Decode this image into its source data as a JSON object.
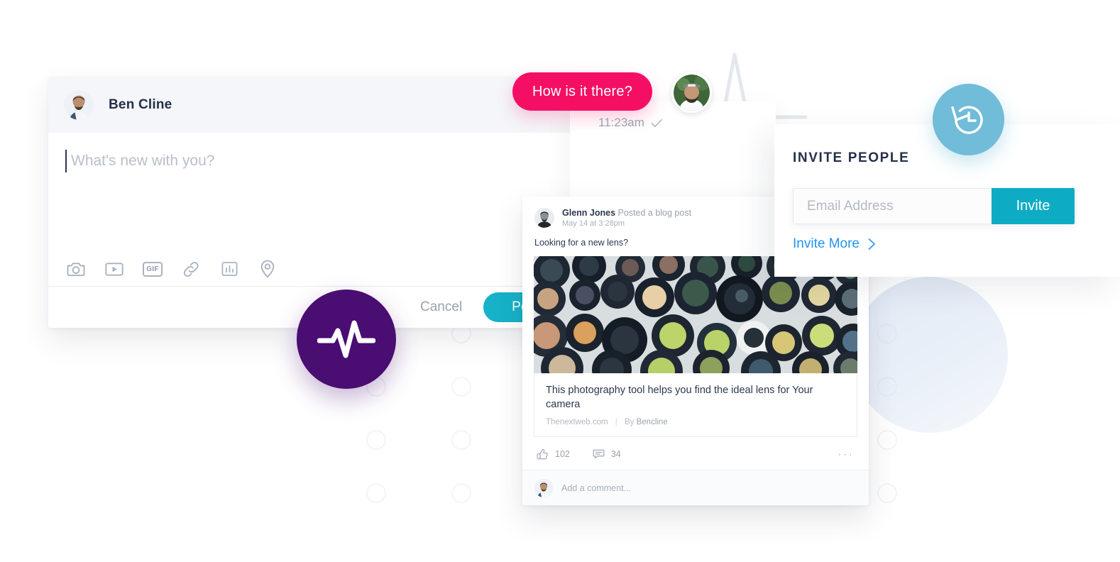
{
  "composer": {
    "user_name": "Ben Cline",
    "placeholder": "What's new with you?",
    "tools": [
      {
        "name": "camera-icon",
        "label": "Photo"
      },
      {
        "name": "video-icon",
        "label": "Video"
      },
      {
        "name": "gif-icon",
        "label": "GIF"
      },
      {
        "name": "link-icon",
        "label": "Link"
      },
      {
        "name": "poll-icon",
        "label": "Poll"
      },
      {
        "name": "location-icon",
        "label": "Location"
      }
    ],
    "gif_label": "GIF",
    "cancel_label": "Cancel",
    "post_label": "Post"
  },
  "chat": {
    "message_text": "How is it there?",
    "timestamp": "11:23am",
    "read_status": "✓",
    "bubble_color": "#f50f64"
  },
  "post": {
    "author": "Glenn Jones",
    "action": "Posted a blog post",
    "time": "May 14 at 3:28pm",
    "body": "Looking for a new lens?",
    "link_title": "This photography tool helps you find the ideal lens for Your camera",
    "link_source": "Thenextweb.com",
    "link_sep": "|",
    "link_by": "By",
    "link_author": "Bencline",
    "likes": "102",
    "comments": "34",
    "more_glyph": "···",
    "comment_placeholder": "Add a comment..."
  },
  "invite": {
    "title": "INVITE PEOPLE",
    "email_placeholder": "Email Address",
    "email_value": "",
    "invite_label": "Invite",
    "invite_more_label": "Invite More",
    "chevron": "›",
    "accent_color": "#0eacc4",
    "link_color": "#2196f3"
  },
  "badges": {
    "history_icon": "history-clock-icon",
    "history_color": "#71bcd8",
    "pulse_icon": "pulse-wave-icon",
    "pulse_color": "#4a0d72"
  }
}
